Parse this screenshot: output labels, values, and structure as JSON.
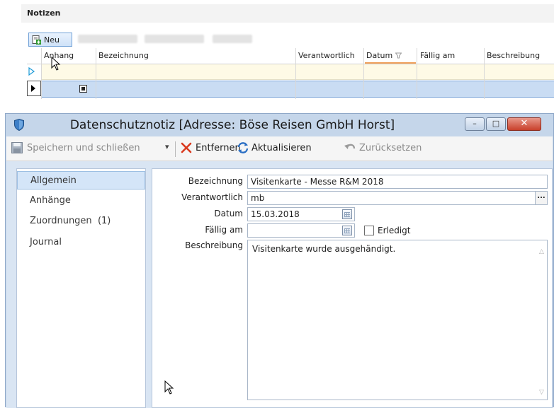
{
  "notes": {
    "title": "Notizen",
    "toolbar": {
      "new_label": "Neu"
    },
    "columns": [
      "Anhang",
      "Bezeichnung",
      "Verantwortlich",
      "Datum",
      "Fällig am",
      "Beschreibung"
    ]
  },
  "dialog": {
    "title": "Datenschutznotiz [Adresse: Böse Reisen GmbH Horst]",
    "window_buttons": {
      "minimize": "–",
      "maximize": "□",
      "close": "✕"
    },
    "ribbon": {
      "save_close": "Speichern und schließen",
      "dropdown": "▾",
      "remove": "Entfernen",
      "refresh": "Aktualisieren",
      "reset": "Zurücksetzen"
    },
    "nav": [
      {
        "label": "Allgemein"
      },
      {
        "label": "Anhänge"
      },
      {
        "label": "Zuordnungen  (1)"
      },
      {
        "label": "Journal"
      }
    ],
    "form": {
      "bezeichnung_label": "Bezeichnung",
      "bezeichnung_value": "Visitenkarte - Messe R&M 2018",
      "verantwortlich_label": "Verantwortlich",
      "verantwortlich_value": "mb",
      "verantwortlich_button": "...",
      "datum_label": "Datum",
      "datum_value": "15.03.2018",
      "faellig_label": "Fällig am",
      "faellig_value": "",
      "erledigt_label": "Erledigt",
      "beschreibung_label": "Beschreibung",
      "beschreibung_value": "Visitenkarte wurde ausgehändigt."
    }
  },
  "colors": {
    "accent_blue": "#2b6fc4",
    "remove_red": "#d93a1f",
    "selected_row": "#c9dcf3",
    "new_row": "#fefae6"
  }
}
